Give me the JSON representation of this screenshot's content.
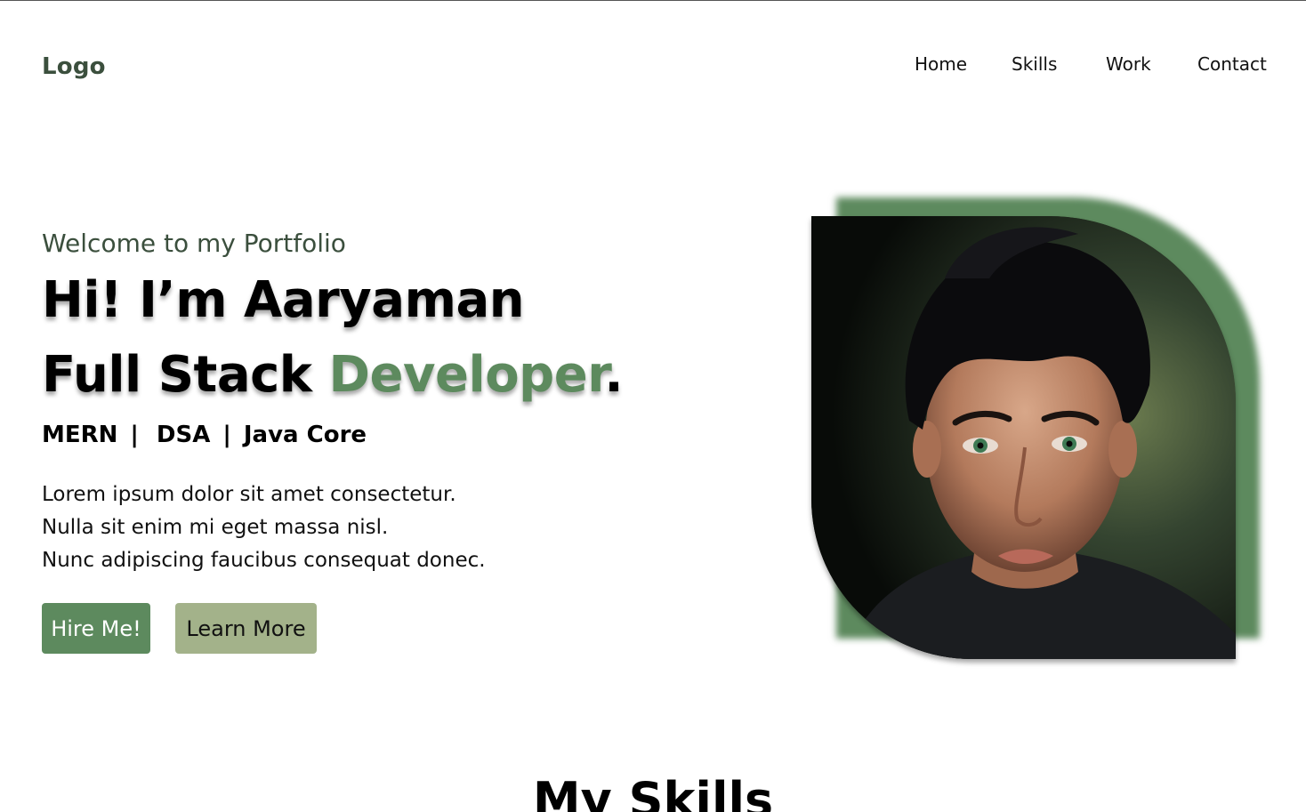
{
  "header": {
    "logo": "Logo",
    "nav": [
      {
        "label": "Home"
      },
      {
        "label": "Skills"
      },
      {
        "label": "Work"
      },
      {
        "label": "Contact"
      }
    ]
  },
  "hero": {
    "welcome": "Welcome to my Portfolio",
    "headline_line1": "Hi! I’m Aaryaman",
    "headline_line2_plain": "Full Stack ",
    "headline_line2_accent": "Developer",
    "headline_line2_period": ".",
    "stack_items": [
      "MERN",
      "DSA",
      "Java Core"
    ],
    "stack_separator": "|",
    "description": [
      "Lorem ipsum dolor sit amet consectetur.",
      "Nulla sit enim mi eget massa nisl.",
      "Nunc adipiscing faucibus consequat donec."
    ],
    "primary_button": "Hire Me!",
    "secondary_button": "Learn More"
  },
  "skills_section": {
    "title": "My Skills"
  },
  "colors": {
    "accent": "#5d8a5e",
    "secondary_button": "#a3b28a",
    "logo_text": "#3b4f3d"
  }
}
